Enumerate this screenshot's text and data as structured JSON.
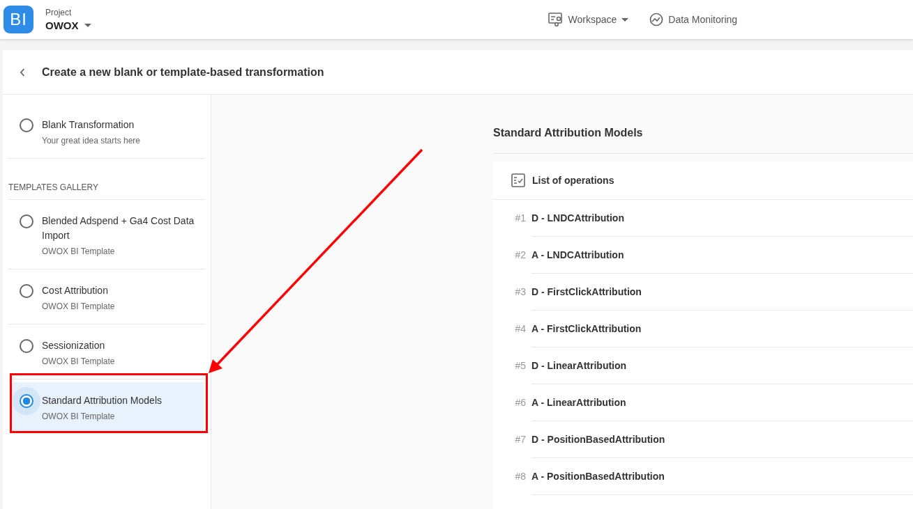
{
  "header": {
    "logo": "BI",
    "project_label": "Project",
    "project_name": "OWOX",
    "nav": [
      {
        "kind": "workspace",
        "label": "Workspace",
        "dropdown": true
      },
      {
        "kind": "monitoring",
        "label": "Data Monitoring",
        "dropdown": false
      }
    ]
  },
  "page": {
    "title": "Create a new blank or template-based transformation"
  },
  "blank": {
    "title": "Blank Transformation",
    "subtitle": "Your great idea starts here",
    "selected": false
  },
  "gallery_heading": "TEMPLATES GALLERY",
  "templates": [
    {
      "title": "Blended Adspend + Ga4 Cost Data Import",
      "subtitle": "OWOX BI Template",
      "selected": false
    },
    {
      "title": "Cost Attribution",
      "subtitle": "OWOX BI Template",
      "selected": false
    },
    {
      "title": "Sessionization",
      "subtitle": "OWOX BI Template",
      "selected": false
    },
    {
      "title": "Standard Attribution Models",
      "subtitle": "OWOX BI Template",
      "selected": true
    }
  ],
  "detail": {
    "title": "Standard Attribution Models",
    "list_title": "List of operations",
    "operations": [
      {
        "number": "#1",
        "name": "D - LNDCAttribution"
      },
      {
        "number": "#2",
        "name": "A - LNDCAttribution"
      },
      {
        "number": "#3",
        "name": "D - FirstClickAttribution"
      },
      {
        "number": "#4",
        "name": "A - FirstClickAttribution"
      },
      {
        "number": "#5",
        "name": "D - LinearAttribution"
      },
      {
        "number": "#6",
        "name": "A - LinearAttribution"
      },
      {
        "number": "#7",
        "name": "D - PositionBasedAttribution"
      },
      {
        "number": "#8",
        "name": "A - PositionBasedAttribution"
      }
    ]
  }
}
